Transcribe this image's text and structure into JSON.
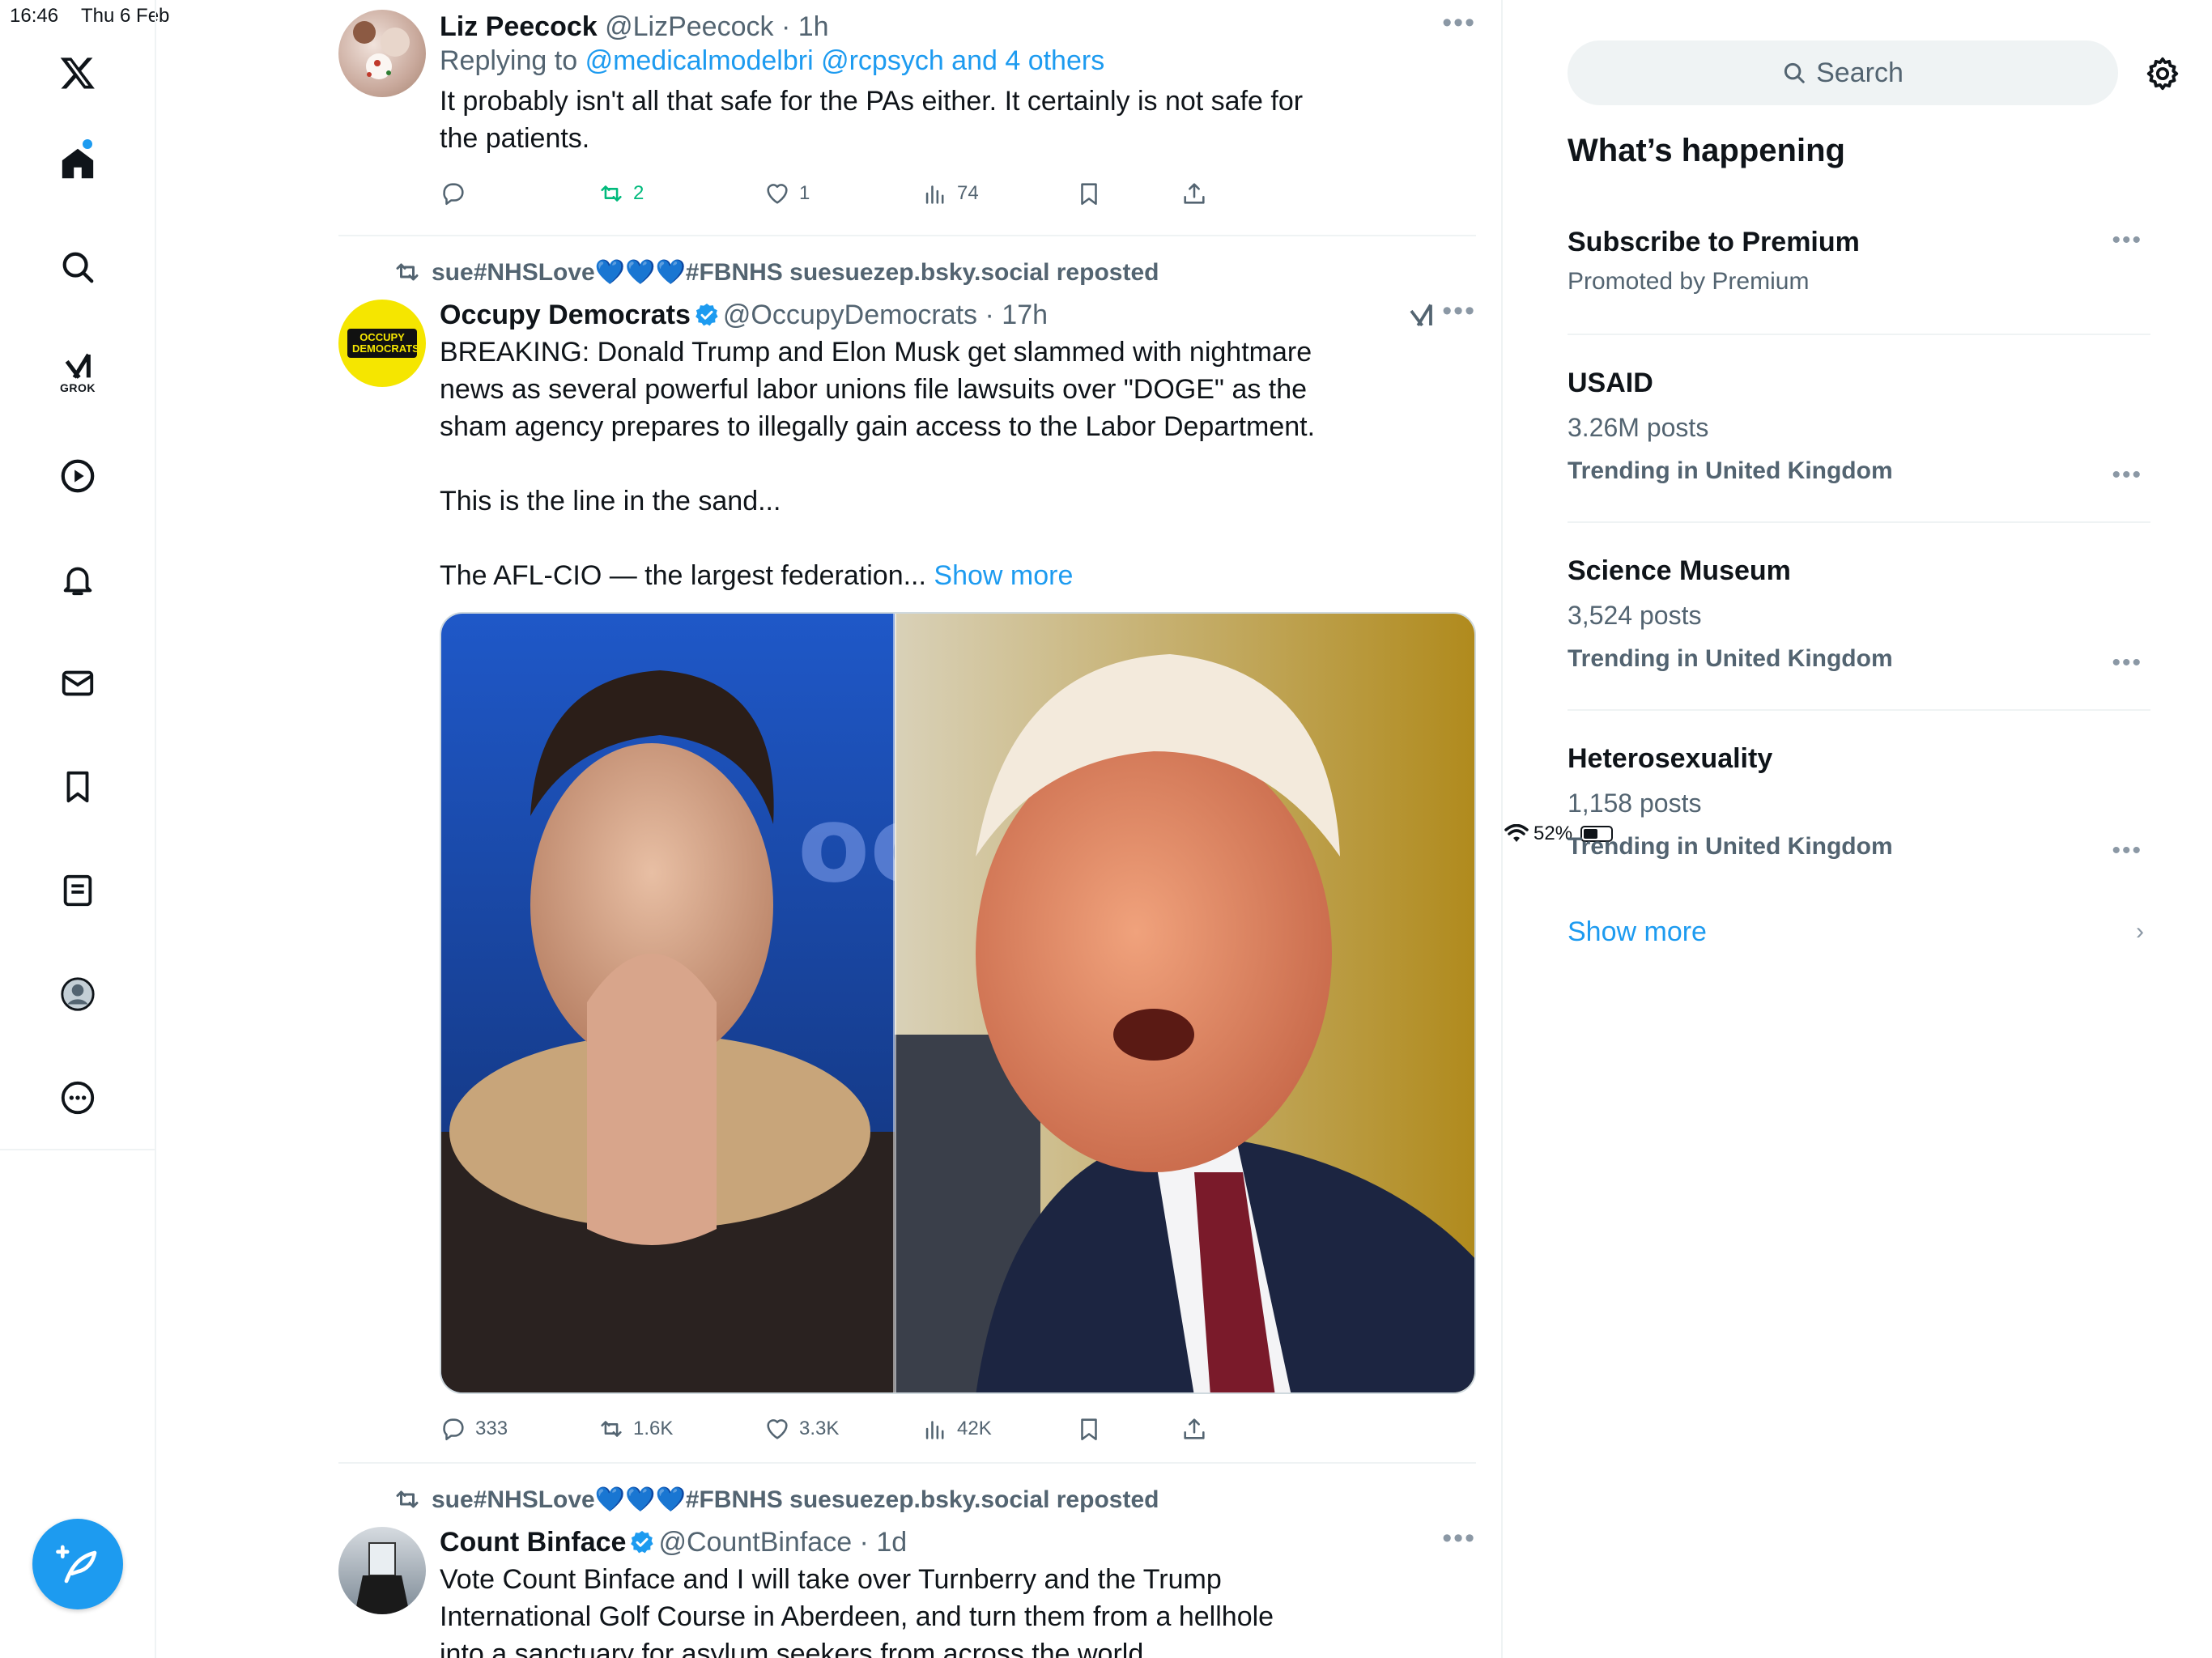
{
  "status_bar": {
    "time": "16:46",
    "date": "Thu 6 Feb",
    "battery": "52%",
    "battery_fraction": 0.52
  },
  "nav": {
    "grok_label": "GROK"
  },
  "tweets": [
    {
      "name": "Liz Peecock",
      "handle": "@LizPeecock",
      "time": "1h",
      "replying_prefix": "Replying to",
      "replying_to": "@medicalmodelbri @rcpsych and 4 others",
      "text_lines": [
        "It probably isn't all that safe for the PAs either. It certainly is not safe for",
        "the patients."
      ],
      "replies": "",
      "reposts": "2",
      "likes": "1",
      "views": "74"
    },
    {
      "reposted_by": "sue#NHSLove💙💙💙#FBNHS suesuezep.bsky.social reposted",
      "name": "Occupy Democrats",
      "handle": "@OccupyDemocrats",
      "time": "17h",
      "avatar_text": "OCCUPY DEMOCRATS",
      "text_lines": [
        "BREAKING: Donald Trump and Elon Musk get slammed with nightmare",
        "news as several powerful labor unions file lawsuits over \"DOGE\" as the",
        "sham agency prepares to illegally gain access to the Labor Department."
      ],
      "text_line2": "This is the line in the sand...",
      "text_line3": "The AFL-CIO —  the largest federation...",
      "show_more": "Show more",
      "replies": "333",
      "reposts": "1.6K",
      "likes": "3.3K",
      "views": "42K"
    },
    {
      "reposted_by": "sue#NHSLove💙💙💙#FBNHS suesuezep.bsky.social reposted",
      "name": "Count Binface",
      "handle": "@CountBinface",
      "time": "1d",
      "text_lines": [
        "Vote Count Binface and I will take over Turnberry and the Trump",
        "International Golf Course in Aberdeen, and turn them from a hellhole",
        "into a sanctuary for asylum seekers from across the world."
      ]
    }
  ],
  "sidebar": {
    "search_placeholder": "Search",
    "heading": "What’s happening",
    "trends": [
      {
        "title": "Subscribe to Premium",
        "sub": "Promoted by Premium",
        "context": ""
      },
      {
        "title": "USAID",
        "sub": "3.26M posts",
        "context": "Trending in United Kingdom"
      },
      {
        "title": "Science Museum",
        "sub": "3,524 posts",
        "context": "Trending in United Kingdom"
      },
      {
        "title": "Heterosexuality",
        "sub": "1,158 posts",
        "context": "Trending in United Kingdom"
      }
    ],
    "show_more": "Show more"
  }
}
